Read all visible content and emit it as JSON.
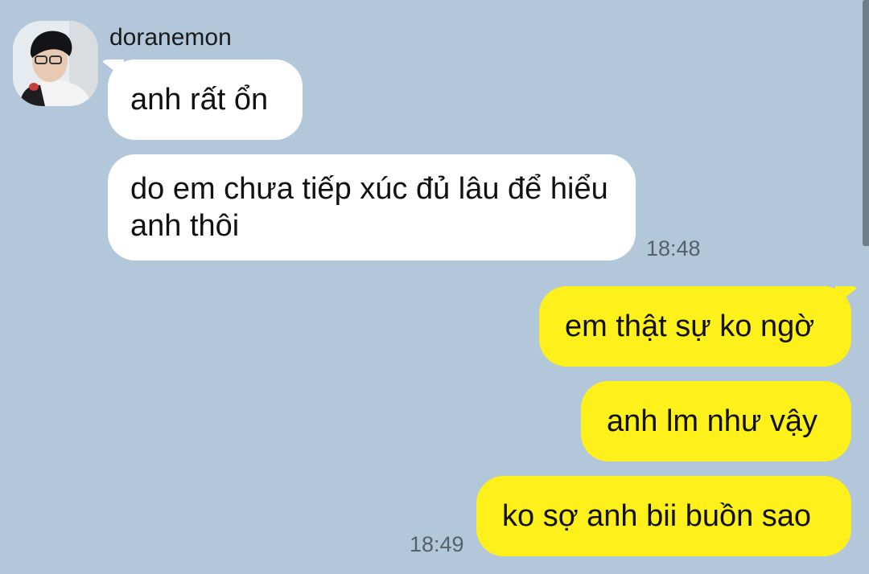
{
  "chat": {
    "sender_name": "doranemon",
    "incoming": [
      {
        "text": "anh rất ổn"
      },
      {
        "text": "do em chưa tiếp xúc đủ lâu để hiểu anh thôi",
        "time": "18:48"
      }
    ],
    "outgoing": [
      {
        "text": "em thật sự ko ngờ"
      },
      {
        "text": "anh lm như vậy"
      },
      {
        "text": "ko sợ anh bii buồn sao",
        "time": "18:49"
      }
    ]
  },
  "colors": {
    "background": "#b2c7da",
    "incoming_bubble": "#ffffff",
    "outgoing_bubble": "#fef01b",
    "timestamp": "#56616b"
  },
  "icons": {
    "avatar": "profile-photo"
  }
}
